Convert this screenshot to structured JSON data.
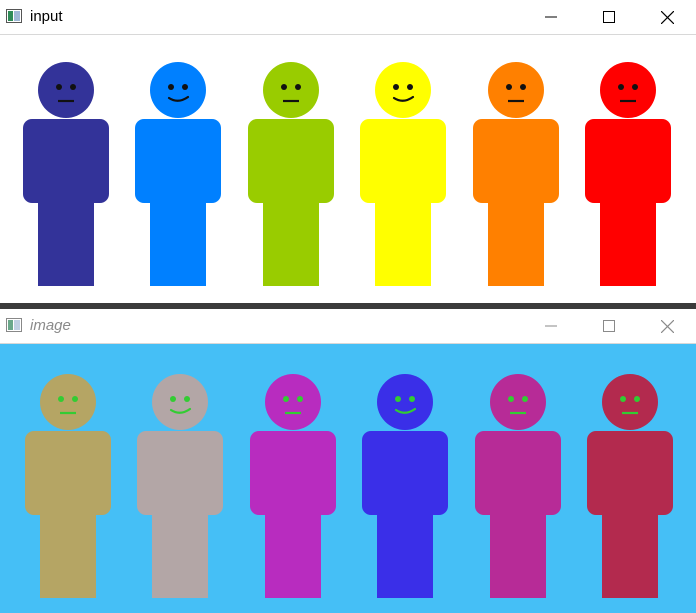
{
  "windows": [
    {
      "title": "input",
      "active": true,
      "canvas_background": "#ffffff",
      "figures": [
        {
          "body": "#333399",
          "eyes": "#111111",
          "mouth": "#111111",
          "expression": "neutral"
        },
        {
          "body": "#0080ff",
          "eyes": "#111111",
          "mouth": "#111111",
          "expression": "smile"
        },
        {
          "body": "#99cc00",
          "eyes": "#111111",
          "mouth": "#111111",
          "expression": "neutral"
        },
        {
          "body": "#ffff00",
          "eyes": "#111111",
          "mouth": "#111111",
          "expression": "smile"
        },
        {
          "body": "#ff8000",
          "eyes": "#111111",
          "mouth": "#111111",
          "expression": "neutral"
        },
        {
          "body": "#ff0000",
          "eyes": "#111111",
          "mouth": "#111111",
          "expression": "neutral"
        }
      ]
    },
    {
      "title": "image",
      "active": false,
      "canvas_background": "#45bff6",
      "figures": [
        {
          "body": "#b5a564",
          "eyes": "#33cc33",
          "mouth": "#33cc33",
          "expression": "neutral"
        },
        {
          "body": "#b3a6a6",
          "eyes": "#33cc33",
          "mouth": "#33cc33",
          "expression": "smile"
        },
        {
          "body": "#b82cbf",
          "eyes": "#33cc33",
          "mouth": "#33cc33",
          "expression": "neutral"
        },
        {
          "body": "#3a2fe8",
          "eyes": "#33cc33",
          "mouth": "#33cc33",
          "expression": "smile"
        },
        {
          "body": "#b72b97",
          "eyes": "#33cc33",
          "mouth": "#33cc33",
          "expression": "neutral"
        },
        {
          "body": "#b32a4e",
          "eyes": "#33cc33",
          "mouth": "#33cc33",
          "expression": "neutral"
        }
      ]
    }
  ]
}
